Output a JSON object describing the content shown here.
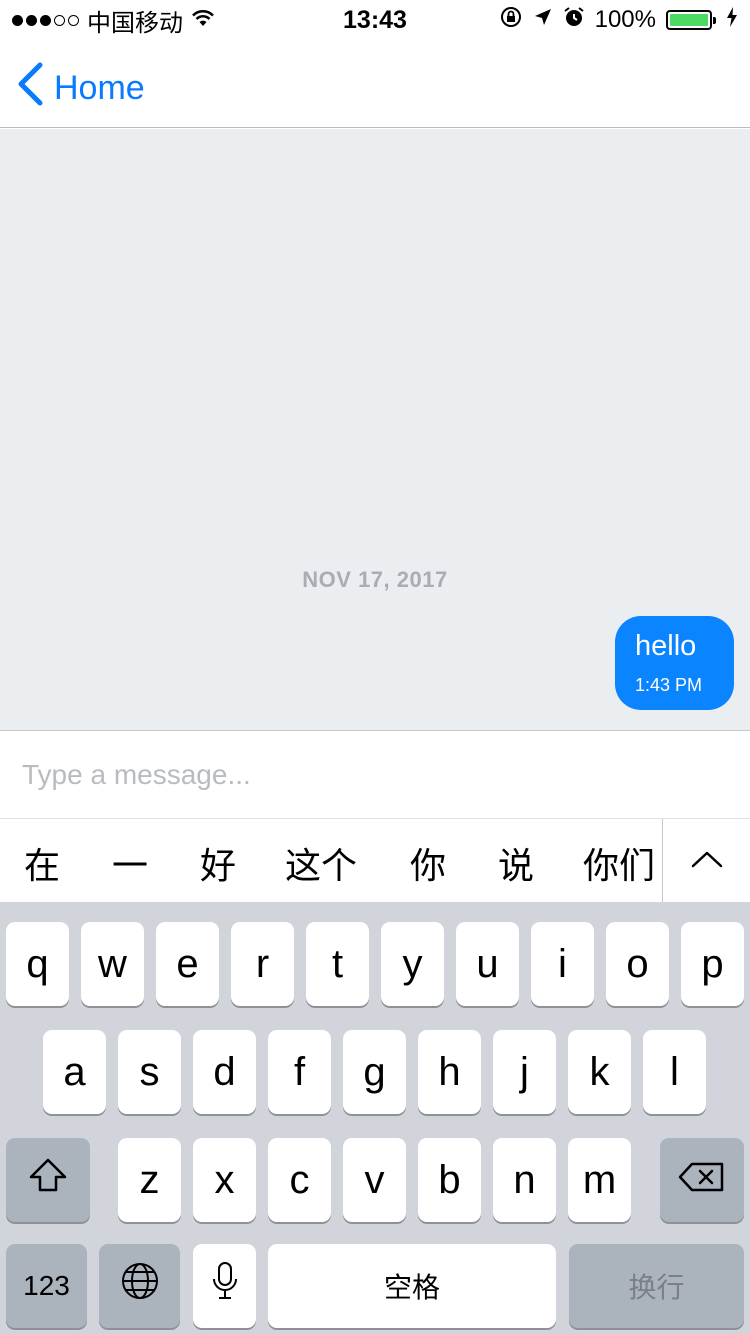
{
  "status_bar": {
    "carrier": "中国移动",
    "time": "13:43",
    "battery": "100%"
  },
  "nav": {
    "back_label": "Home"
  },
  "chat": {
    "date_separator": "NOV 17, 2017",
    "messages": [
      {
        "text": "hello",
        "time": "1:43 PM",
        "color": "#0a84ff"
      }
    ]
  },
  "composer": {
    "placeholder": "Type a message..."
  },
  "candidates": [
    "在",
    "一",
    "好",
    "这个",
    "你",
    "说",
    "你们"
  ],
  "keyboard": {
    "row1": [
      "q",
      "w",
      "e",
      "r",
      "t",
      "y",
      "u",
      "i",
      "o",
      "p"
    ],
    "row2": [
      "a",
      "s",
      "d",
      "f",
      "g",
      "h",
      "j",
      "k",
      "l"
    ],
    "row3": [
      "z",
      "x",
      "c",
      "v",
      "b",
      "n",
      "m"
    ],
    "numbers_label": "123",
    "space_label": "空格",
    "return_label": "换行"
  },
  "colors": {
    "accent": "#0a7aff",
    "bubble": "#0a84ff",
    "battery": "#4cd964"
  },
  "icons": [
    "wifi-icon",
    "rotation-lock-icon",
    "location-arrow-icon",
    "alarm-icon",
    "charging-icon",
    "chevron-left-icon",
    "chevron-up-icon",
    "shift-icon",
    "delete-icon",
    "globe-icon",
    "microphone-icon"
  ]
}
